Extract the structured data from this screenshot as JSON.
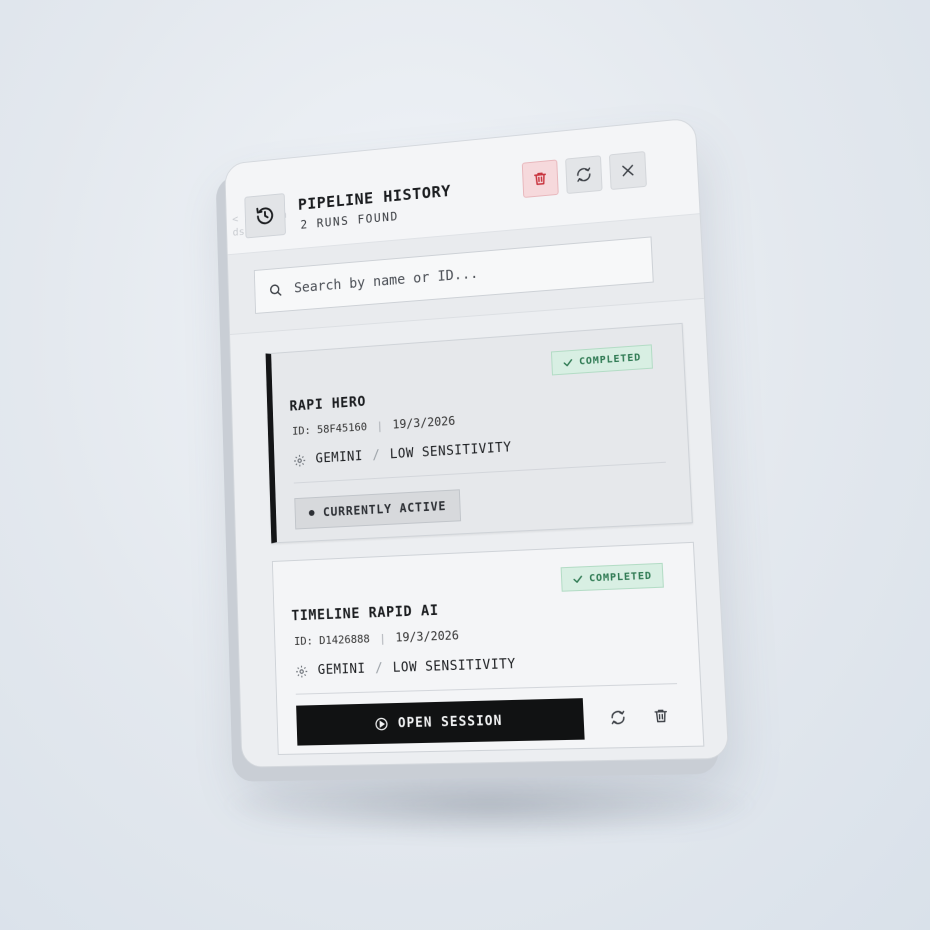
{
  "header": {
    "title": "PIPELINE HISTORY",
    "subtitle": "2 RUNS FOUND",
    "ghost_lines": [
      "< Chauhan",
      "ds"
    ]
  },
  "search": {
    "placeholder": "Search by name or ID..."
  },
  "runs": [
    {
      "name": "RAPI HERO",
      "id": "ID: 58F45160",
      "date": "19/3/2026",
      "status": "COMPLETED",
      "provider": "GEMINI",
      "sensitivity": "LOW SENSITIVITY",
      "active_label": "CURRENTLY ACTIVE"
    },
    {
      "name": "TIMELINE RAPID AI",
      "id": "ID: D1426888",
      "date": "19/3/2026",
      "status": "COMPLETED",
      "provider": "GEMINI",
      "sensitivity": "LOW SENSITIVITY",
      "action_label": "OPEN SESSION"
    }
  ],
  "colors": {
    "delete_accent": "#c8323c",
    "completed_green": "#2f7a53",
    "primary_button": "#111213"
  },
  "icons": [
    "history-icon",
    "trash-icon",
    "refresh-icon",
    "close-icon",
    "search-icon",
    "check-icon",
    "gear-icon",
    "play-circle-icon"
  ]
}
